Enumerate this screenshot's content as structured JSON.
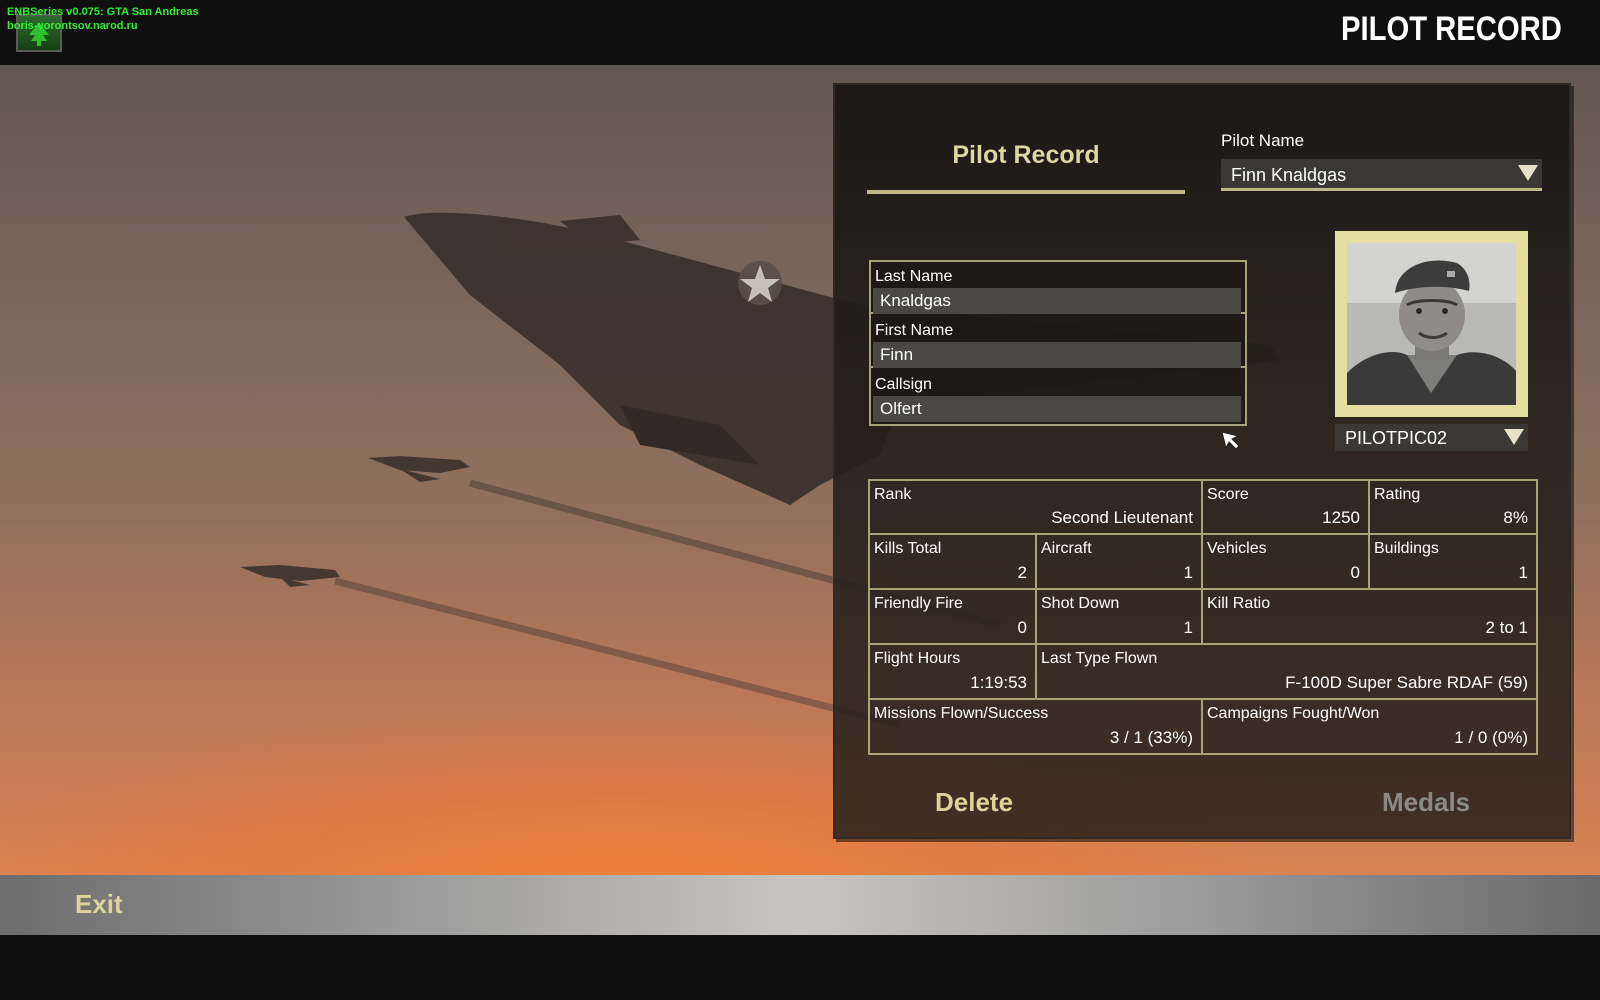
{
  "overlay": {
    "line1": "ENBSeries v0.075: GTA San Andreas",
    "line2": "boris-vorontsov.narod.ru"
  },
  "screen_title": "PILOT RECORD",
  "panel": {
    "heading": "Pilot Record",
    "pilot_name_label": "Pilot Name",
    "pilot_name_value": "Finn Knaldgas",
    "last_name_label": "Last Name",
    "last_name_value": "Knaldgas",
    "first_name_label": "First Name",
    "first_name_value": "Finn",
    "callsign_label": "Callsign",
    "callsign_value": "Olfert",
    "portrait_value": "PILOTPIC02",
    "delete_label": "Delete",
    "medals_label": "Medals"
  },
  "stats": {
    "rank": {
      "label": "Rank",
      "value": "Second Lieutenant"
    },
    "score": {
      "label": "Score",
      "value": "1250"
    },
    "rating": {
      "label": "Rating",
      "value": "8%"
    },
    "kills_total": {
      "label": "Kills Total",
      "value": "2"
    },
    "aircraft": {
      "label": "Aircraft",
      "value": "1"
    },
    "vehicles": {
      "label": "Vehicles",
      "value": "0"
    },
    "buildings": {
      "label": "Buildings",
      "value": "1"
    },
    "friendly_fire": {
      "label": "Friendly Fire",
      "value": "0"
    },
    "shot_down": {
      "label": "Shot Down",
      "value": "1"
    },
    "kill_ratio": {
      "label": "Kill Ratio",
      "value": "2 to 1"
    },
    "flight_hours": {
      "label": "Flight Hours",
      "value": "1:19:53"
    },
    "last_type_flown": {
      "label": "Last Type Flown",
      "value": "F-100D Super Sabre RDAF (59)"
    },
    "missions": {
      "label": "Missions Flown/Success",
      "value": "3 / 1 (33%)"
    },
    "campaigns": {
      "label": "Campaigns Fought/Won",
      "value": "1 / 0 (0%)"
    }
  },
  "bottom": {
    "exit_label": "Exit"
  },
  "colors": {
    "accent_text": "#ddd5a2",
    "frame": "#a8a27a",
    "disabled_text": "#8a8a86"
  }
}
